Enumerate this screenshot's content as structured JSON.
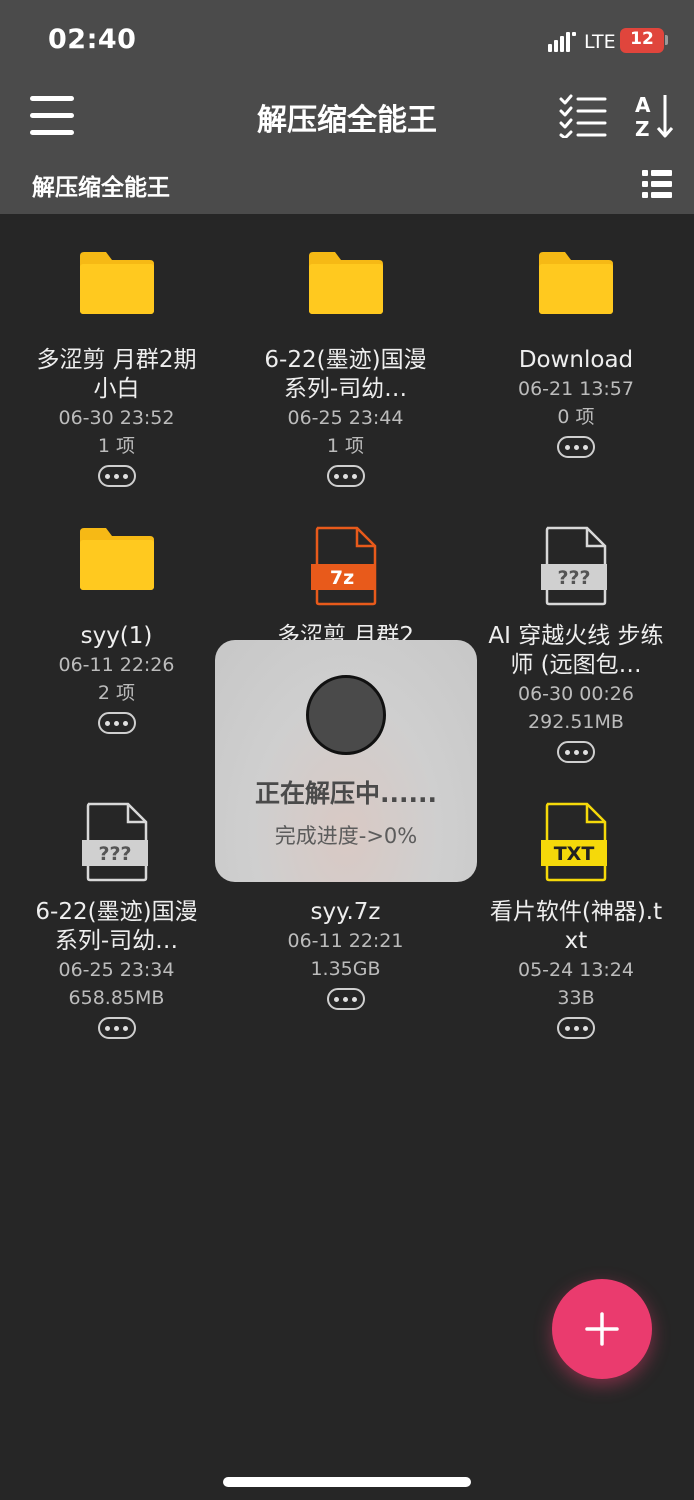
{
  "status": {
    "time": "02:40",
    "network": "LTE",
    "battery": "12"
  },
  "toolbar": {
    "title": "解压缩全能王",
    "menu_icon": "hamburger-menu-icon",
    "check_icon": "checklist-icon",
    "sort_icon": "sort-az-icon"
  },
  "breadcrumb": {
    "path": "解压缩全能王",
    "view_icon": "list-view-icon"
  },
  "files": [
    {
      "name": "多涩剪 月群2期小白",
      "date": "06-30 23:52",
      "info": "1 项",
      "icon": "folder-icon"
    },
    {
      "name": "6-22(墨迹)国漫系列-司幼…",
      "date": "06-25 23:44",
      "info": "1 项",
      "icon": "folder-icon"
    },
    {
      "name": "Download",
      "date": "06-21 13:57",
      "info": "0 项",
      "icon": "folder-icon"
    },
    {
      "name": "syy(1)",
      "date": "06-11 22:26",
      "info": "2 项",
      "icon": "folder-icon"
    },
    {
      "name": "多涩剪 月群2",
      "date": "",
      "info": "",
      "icon": "archive-7z-icon",
      "badge": "7z",
      "badge_color": "#e85a1b"
    },
    {
      "name": "AI 穿越火线 步练师 (远图包…",
      "date": "06-30 00:26",
      "info": "292.51MB",
      "icon": "unknown-file-icon",
      "badge": "???",
      "badge_color": "#555555"
    },
    {
      "name": "6-22(墨迹)国漫系列-司幼…",
      "date": "06-25 23:34",
      "info": "658.85MB",
      "icon": "unknown-file-icon",
      "badge": "???",
      "badge_color": "#555555"
    },
    {
      "name": "syy.7z",
      "date": "06-11 22:21",
      "info": "1.35GB",
      "icon": "archive-7z-icon"
    },
    {
      "name": "看片软件(神器).txt",
      "date": "05-24 13:24",
      "info": "33B",
      "icon": "txt-file-icon",
      "badge": "TXT",
      "badge_color": "#f5d90a"
    }
  ],
  "dialog": {
    "title": "正在解压中......",
    "progress_text": "完成进度->0%",
    "progress": 0
  },
  "fab": {
    "icon": "plus-icon"
  },
  "colors": {
    "accent": "#ea3b6e",
    "folder": "#ffc91f",
    "bar": "#4b4b4b",
    "background": "#262626"
  }
}
